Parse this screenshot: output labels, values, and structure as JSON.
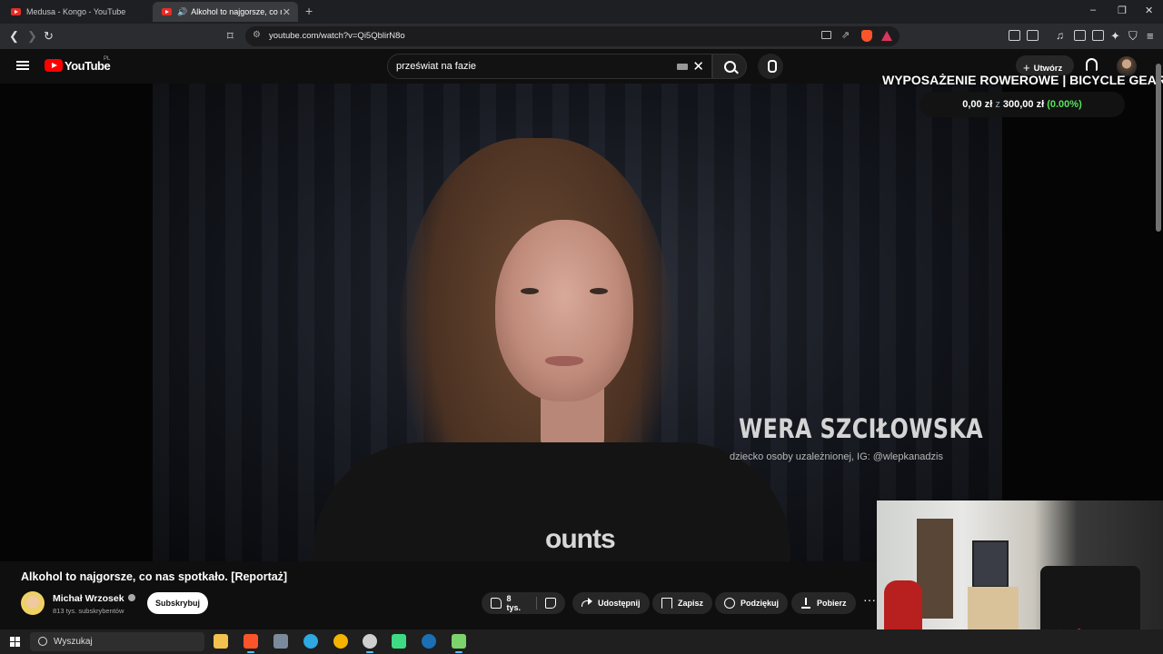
{
  "browser": {
    "tabs": [
      {
        "label": "Medusa - Kongo - YouTube",
        "active": false
      },
      {
        "label": "Alkohol to najgorsze, co nas spotkało...",
        "active": true
      }
    ],
    "new_tab": "+",
    "url": "youtube.com/watch?v=Qi5QblirN8o",
    "window_controls": [
      "–",
      "❐",
      "✕"
    ]
  },
  "youtube": {
    "logo_text": "YouTube",
    "region": "PL",
    "search": {
      "value": "przeświat na fazie",
      "clear": "✕"
    },
    "create_label": "Utwórz",
    "create_plus": "+"
  },
  "video": {
    "lower_third_name": "WERA SZCIŁOWSKA",
    "lower_third_sub": "dziecko osoby uzależnionej, IG: @wlepkanadzis",
    "shirt_print": "ounts"
  },
  "overlay": {
    "goal_title": "WYPOSAŻENIE ROWEROWE | BICYCLE GEAR",
    "goal_current": "0,00 zł",
    "goal_of": "z",
    "goal_target": "300,00 zł",
    "goal_percent": "(0.00%)"
  },
  "meta": {
    "title": "Alkohol to najgorsze, co nas spotkało. [Reportaż]",
    "channel_name": "Michał Wrzosek",
    "subscribers": "813 tys. subskrybentów",
    "subscribe_label": "Subskrybuj",
    "likes": "8 tys.",
    "share_label": "Udostępnij",
    "save_label": "Zapisz",
    "thanks_label": "Podziękuj",
    "download_label": "Pobierz",
    "more": "···"
  },
  "taskbar": {
    "search_placeholder": "Wyszukaj",
    "apps": [
      {
        "name": "file-explorer",
        "color": "#f2c14e"
      },
      {
        "name": "brave",
        "color": "#fb542b"
      },
      {
        "name": "store",
        "color": "#7a8a9a"
      },
      {
        "name": "edge",
        "color": "#2ea8e0"
      },
      {
        "name": "chrome",
        "color": "#f4b400"
      },
      {
        "name": "obs",
        "color": "#cfcfcf"
      },
      {
        "name": "play",
        "color": "#3ddc84"
      },
      {
        "name": "steam",
        "color": "#1b6fb5"
      },
      {
        "name": "app-green",
        "color": "#7dd36b"
      }
    ]
  }
}
